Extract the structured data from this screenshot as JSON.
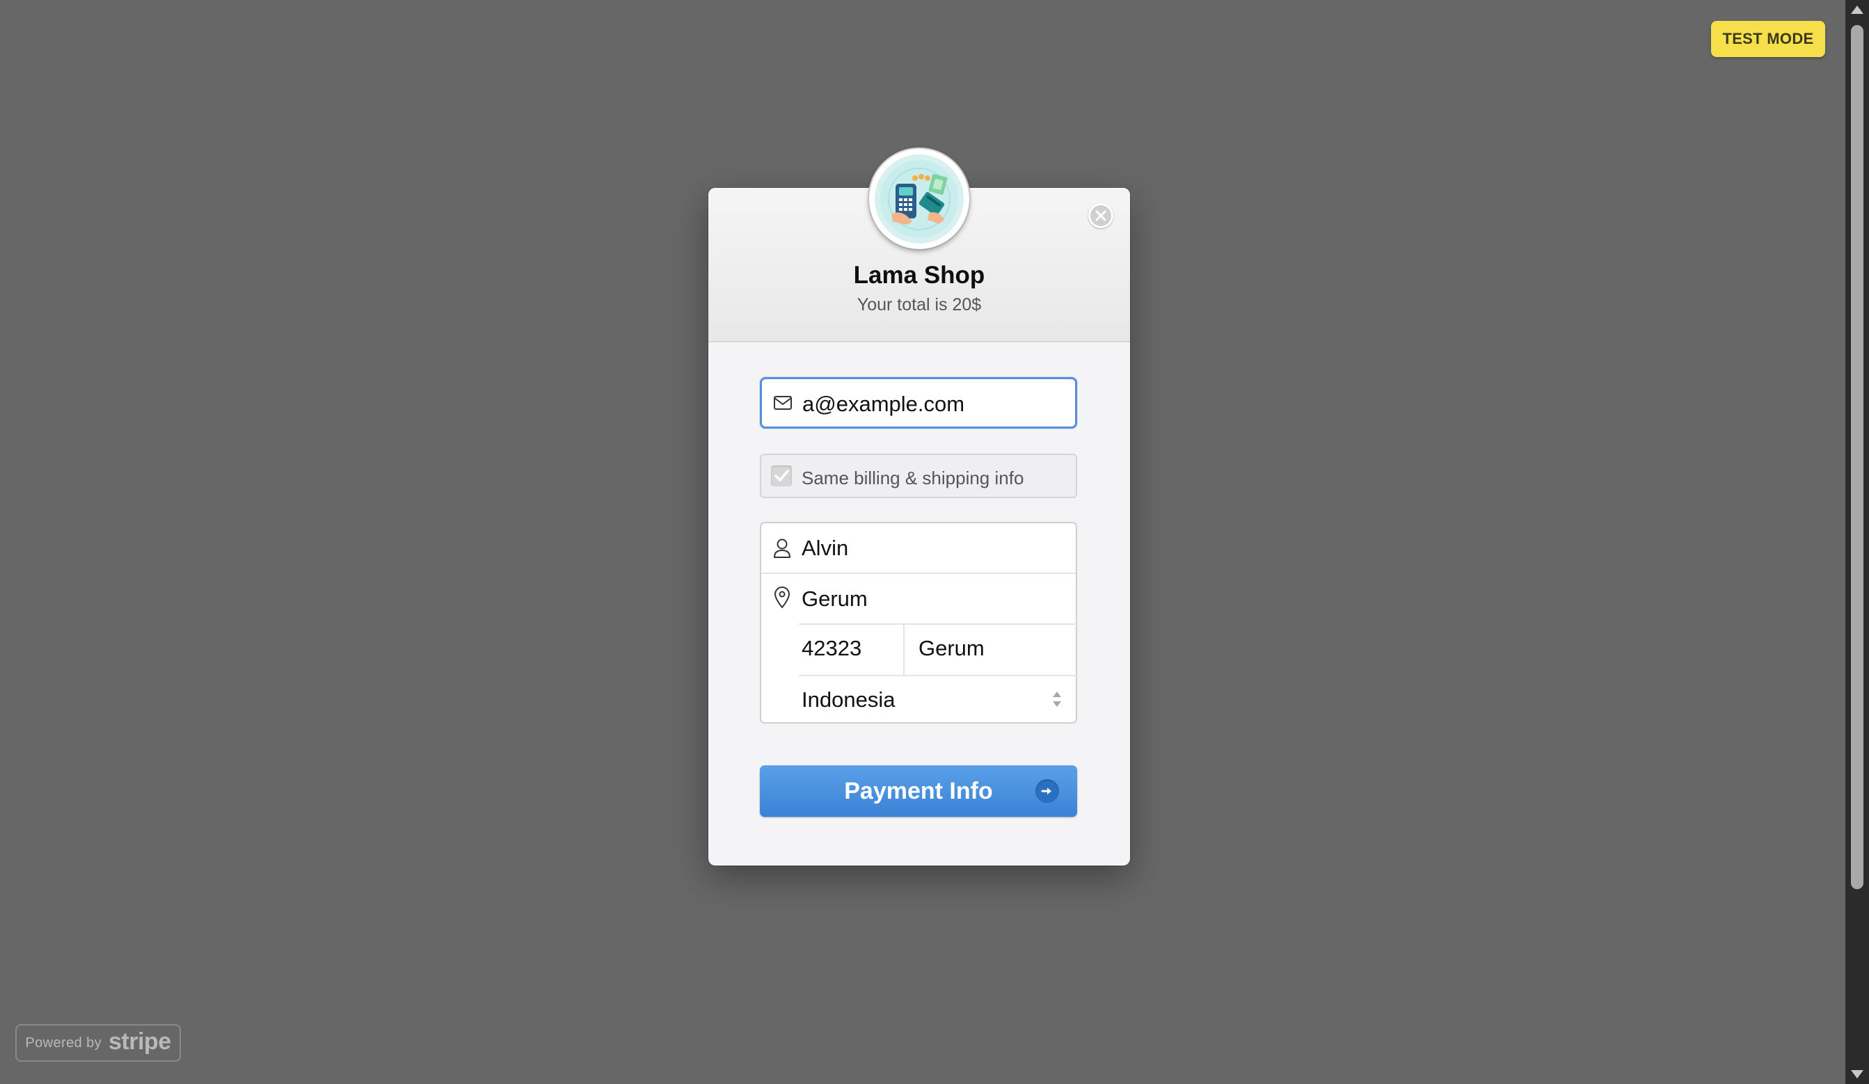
{
  "badge": {
    "label": "TEST MODE"
  },
  "footer": {
    "powered_by": "Powered by",
    "brand": "stripe"
  },
  "modal": {
    "shop_name": "Lama Shop",
    "total_text": "Your total is 20$",
    "email": {
      "value": "a@example.com",
      "icon": "envelope-icon"
    },
    "same_info": {
      "label": "Same billing & shipping info",
      "checked": true
    },
    "address": {
      "name": "Alvin",
      "street": "Gerum",
      "zip": "42323",
      "city": "Gerum",
      "country": "Indonesia"
    },
    "submit_label": "Payment Info"
  },
  "colors": {
    "overlay": "#676767",
    "badge": "#f5e04c",
    "button": "#4a90e2",
    "focus_border": "#5a8fd8"
  }
}
